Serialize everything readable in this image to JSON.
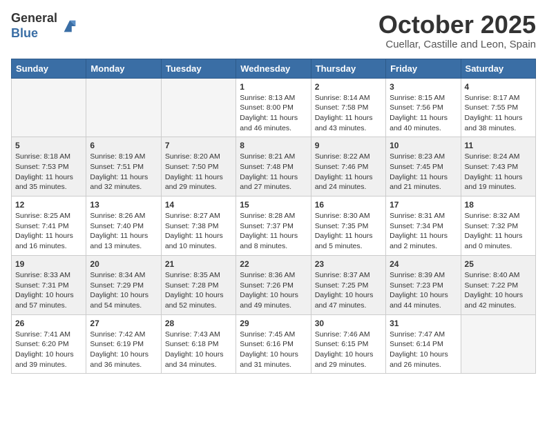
{
  "header": {
    "logo_line1": "General",
    "logo_line2": "Blue",
    "month": "October 2025",
    "location": "Cuellar, Castille and Leon, Spain"
  },
  "weekdays": [
    "Sunday",
    "Monday",
    "Tuesday",
    "Wednesday",
    "Thursday",
    "Friday",
    "Saturday"
  ],
  "weeks": [
    [
      {
        "date": "",
        "content": ""
      },
      {
        "date": "",
        "content": ""
      },
      {
        "date": "",
        "content": ""
      },
      {
        "date": "1",
        "content": "Sunrise: 8:13 AM\nSunset: 8:00 PM\nDaylight: 11 hours and 46 minutes."
      },
      {
        "date": "2",
        "content": "Sunrise: 8:14 AM\nSunset: 7:58 PM\nDaylight: 11 hours and 43 minutes."
      },
      {
        "date": "3",
        "content": "Sunrise: 8:15 AM\nSunset: 7:56 PM\nDaylight: 11 hours and 40 minutes."
      },
      {
        "date": "4",
        "content": "Sunrise: 8:17 AM\nSunset: 7:55 PM\nDaylight: 11 hours and 38 minutes."
      }
    ],
    [
      {
        "date": "5",
        "content": "Sunrise: 8:18 AM\nSunset: 7:53 PM\nDaylight: 11 hours and 35 minutes."
      },
      {
        "date": "6",
        "content": "Sunrise: 8:19 AM\nSunset: 7:51 PM\nDaylight: 11 hours and 32 minutes."
      },
      {
        "date": "7",
        "content": "Sunrise: 8:20 AM\nSunset: 7:50 PM\nDaylight: 11 hours and 29 minutes."
      },
      {
        "date": "8",
        "content": "Sunrise: 8:21 AM\nSunset: 7:48 PM\nDaylight: 11 hours and 27 minutes."
      },
      {
        "date": "9",
        "content": "Sunrise: 8:22 AM\nSunset: 7:46 PM\nDaylight: 11 hours and 24 minutes."
      },
      {
        "date": "10",
        "content": "Sunrise: 8:23 AM\nSunset: 7:45 PM\nDaylight: 11 hours and 21 minutes."
      },
      {
        "date": "11",
        "content": "Sunrise: 8:24 AM\nSunset: 7:43 PM\nDaylight: 11 hours and 19 minutes."
      }
    ],
    [
      {
        "date": "12",
        "content": "Sunrise: 8:25 AM\nSunset: 7:41 PM\nDaylight: 11 hours and 16 minutes."
      },
      {
        "date": "13",
        "content": "Sunrise: 8:26 AM\nSunset: 7:40 PM\nDaylight: 11 hours and 13 minutes."
      },
      {
        "date": "14",
        "content": "Sunrise: 8:27 AM\nSunset: 7:38 PM\nDaylight: 11 hours and 10 minutes."
      },
      {
        "date": "15",
        "content": "Sunrise: 8:28 AM\nSunset: 7:37 PM\nDaylight: 11 hours and 8 minutes."
      },
      {
        "date": "16",
        "content": "Sunrise: 8:30 AM\nSunset: 7:35 PM\nDaylight: 11 hours and 5 minutes."
      },
      {
        "date": "17",
        "content": "Sunrise: 8:31 AM\nSunset: 7:34 PM\nDaylight: 11 hours and 2 minutes."
      },
      {
        "date": "18",
        "content": "Sunrise: 8:32 AM\nSunset: 7:32 PM\nDaylight: 11 hours and 0 minutes."
      }
    ],
    [
      {
        "date": "19",
        "content": "Sunrise: 8:33 AM\nSunset: 7:31 PM\nDaylight: 10 hours and 57 minutes."
      },
      {
        "date": "20",
        "content": "Sunrise: 8:34 AM\nSunset: 7:29 PM\nDaylight: 10 hours and 54 minutes."
      },
      {
        "date": "21",
        "content": "Sunrise: 8:35 AM\nSunset: 7:28 PM\nDaylight: 10 hours and 52 minutes."
      },
      {
        "date": "22",
        "content": "Sunrise: 8:36 AM\nSunset: 7:26 PM\nDaylight: 10 hours and 49 minutes."
      },
      {
        "date": "23",
        "content": "Sunrise: 8:37 AM\nSunset: 7:25 PM\nDaylight: 10 hours and 47 minutes."
      },
      {
        "date": "24",
        "content": "Sunrise: 8:39 AM\nSunset: 7:23 PM\nDaylight: 10 hours and 44 minutes."
      },
      {
        "date": "25",
        "content": "Sunrise: 8:40 AM\nSunset: 7:22 PM\nDaylight: 10 hours and 42 minutes."
      }
    ],
    [
      {
        "date": "26",
        "content": "Sunrise: 7:41 AM\nSunset: 6:20 PM\nDaylight: 10 hours and 39 minutes."
      },
      {
        "date": "27",
        "content": "Sunrise: 7:42 AM\nSunset: 6:19 PM\nDaylight: 10 hours and 36 minutes."
      },
      {
        "date": "28",
        "content": "Sunrise: 7:43 AM\nSunset: 6:18 PM\nDaylight: 10 hours and 34 minutes."
      },
      {
        "date": "29",
        "content": "Sunrise: 7:45 AM\nSunset: 6:16 PM\nDaylight: 10 hours and 31 minutes."
      },
      {
        "date": "30",
        "content": "Sunrise: 7:46 AM\nSunset: 6:15 PM\nDaylight: 10 hours and 29 minutes."
      },
      {
        "date": "31",
        "content": "Sunrise: 7:47 AM\nSunset: 6:14 PM\nDaylight: 10 hours and 26 minutes."
      },
      {
        "date": "",
        "content": ""
      }
    ]
  ]
}
